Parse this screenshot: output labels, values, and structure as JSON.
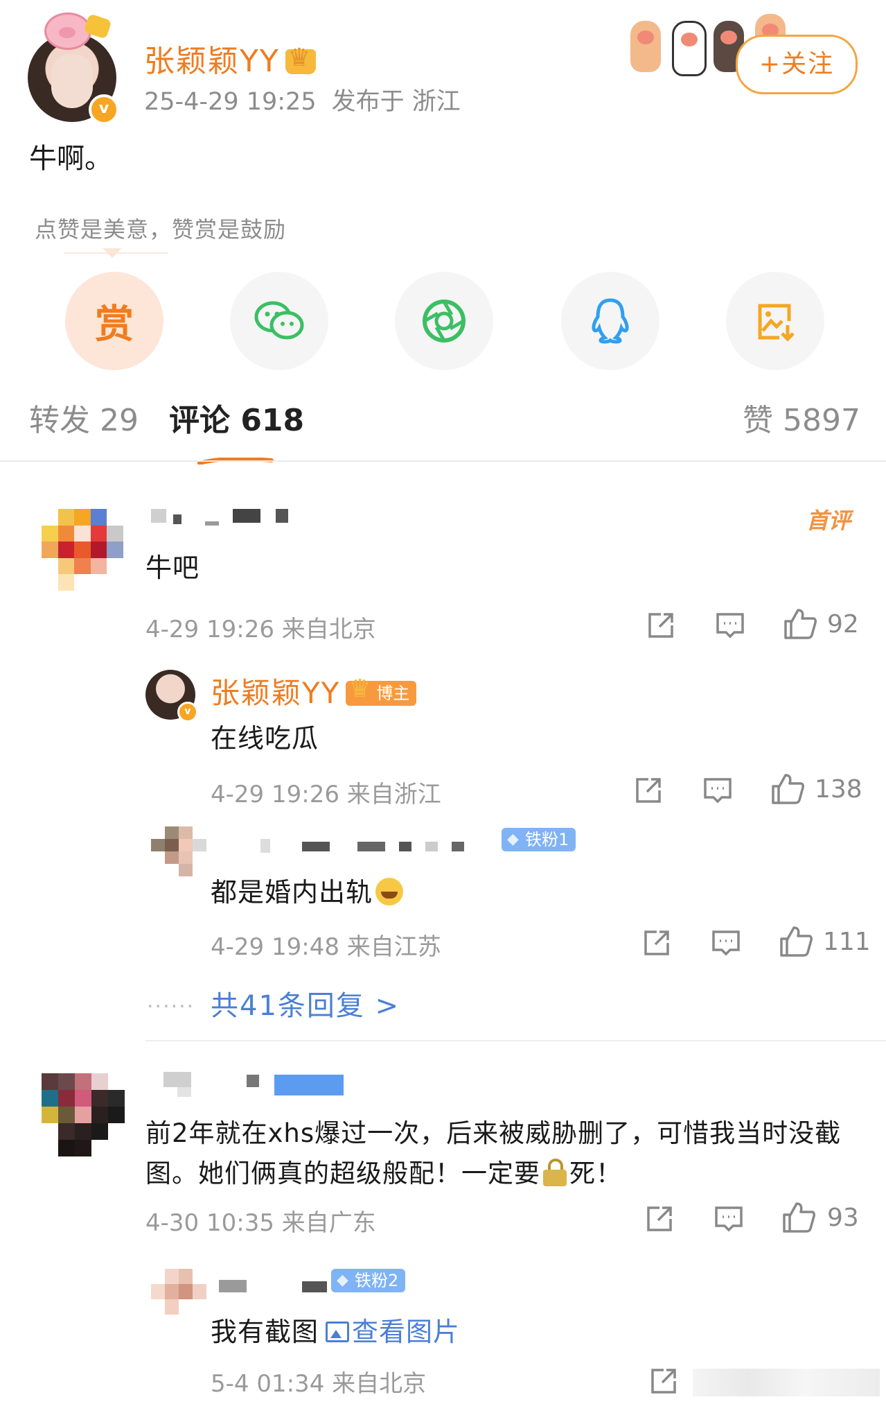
{
  "post": {
    "author_name": "张颖颖YY",
    "timestamp": "25-4-29 19:25",
    "location": "发布于 浙江",
    "follow_label": "+关注",
    "text": "牛啊。",
    "verified_mark": "v"
  },
  "reward": {
    "tip": "点赞是美意，赞赏是鼓励",
    "reward_glyph": "赏"
  },
  "share_buttons": [
    {
      "icon": "reward-icon"
    },
    {
      "icon": "wechat-icon"
    },
    {
      "icon": "moments-icon"
    },
    {
      "icon": "qq-icon"
    },
    {
      "icon": "save-image-icon"
    }
  ],
  "tabs": {
    "repost": "转发 29",
    "comments": "评论 618",
    "likes": "赞 5897"
  },
  "colors": {
    "accent_orange": "#f07c1e",
    "link_blue": "#4a7fd4",
    "meta_gray": "#9a9a9a"
  },
  "comments": [
    {
      "badge": "首评",
      "text": "牛吧",
      "time": "4-29 19:26",
      "location": "来自北京",
      "likes": "92",
      "replies": [
        {
          "name": "张颖颖YY",
          "badge": "博主",
          "text": "在线吃瓜",
          "time": "4-29 19:26",
          "location": "来自浙江",
          "likes": "138"
        },
        {
          "fan_badge": "铁粉1",
          "text": "都是婚内出轨",
          "time": "4-29 19:48",
          "location": "来自江苏",
          "likes": "111"
        }
      ],
      "more_replies": "共41条回复 >",
      "more_dots": "......"
    },
    {
      "text_line1": "前2年就在xhs爆过一次，后来被威胁删了，可惜我当时没截",
      "text_line2_a": "图。她们俩真的超级般配！一定要",
      "text_line2_b": "死！",
      "time": "4-30 10:35",
      "location": "来自广东",
      "likes": "93",
      "replies": [
        {
          "fan_badge": "铁粉2",
          "text": "我有截图",
          "link": "查看图片",
          "time": "5-4 01:34",
          "location": "来自北京"
        }
      ]
    }
  ]
}
